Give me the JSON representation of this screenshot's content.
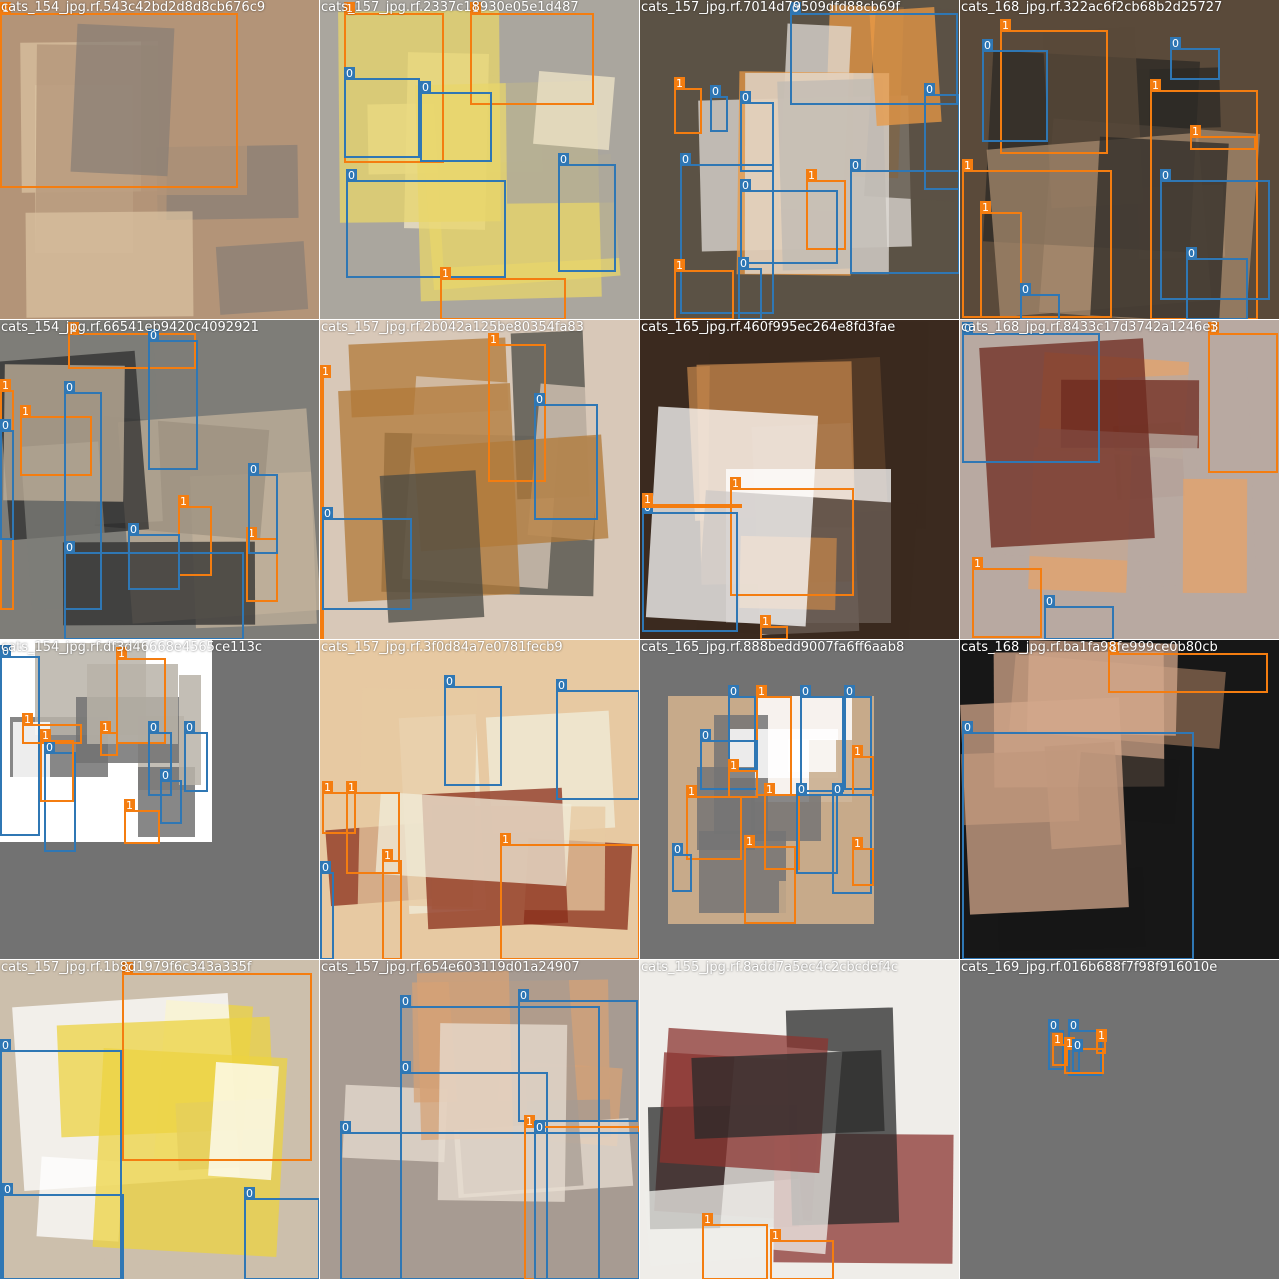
{
  "mosaic": {
    "colors": {
      "class_0": "#2f77b4",
      "class_1": "#f47d10",
      "padding": "#727272"
    },
    "class_labels": [
      "0",
      "1"
    ],
    "tiles": [
      {
        "title": "cats_154_jpg.rf.543c42bd2d8d8cb676c9",
        "palette": [
          "#b39478",
          "#d9c2a0",
          "#8a7f76"
        ],
        "boxes": [
          {
            "cls": "1",
            "l": 0,
            "t": 0,
            "w": 238,
            "h": 175
          }
        ]
      },
      {
        "title": "cats_157_jpg.rf.2337c18930e05e1d487",
        "palette": [
          "#aaa69e",
          "#f0e6c8",
          "#e8d56a"
        ],
        "boxes": [
          {
            "cls": "1",
            "l": 24,
            "t": 10,
            "w": 100,
            "h": 150
          },
          {
            "cls": "1",
            "l": 150,
            "t": 12,
            "w": 124,
            "h": 92
          },
          {
            "cls": "0",
            "l": 24,
            "t": 78,
            "w": 76,
            "h": 80
          },
          {
            "cls": "0",
            "l": 100,
            "t": 92,
            "w": 72,
            "h": 70
          },
          {
            "cls": "0",
            "l": 26,
            "t": 180,
            "w": 160,
            "h": 98
          },
          {
            "cls": "0",
            "l": 238,
            "t": 164,
            "w": 58,
            "h": 108
          },
          {
            "cls": "1",
            "l": 120,
            "t": 278,
            "w": 126,
            "h": 42
          }
        ]
      },
      {
        "title": "cats_157_jpg.rf.7014d79509dfd88cb69f",
        "palette": [
          "#5b5245",
          "#e2ddd8",
          "#e99a45"
        ],
        "boxes": [
          {
            "cls": "0",
            "l": 150,
            "t": 0,
            "w": 168,
            "h": 92
          },
          {
            "cls": "1",
            "l": 34,
            "t": 88,
            "w": 28,
            "h": 46
          },
          {
            "cls": "0",
            "l": 70,
            "t": 96,
            "w": 18,
            "h": 36
          },
          {
            "cls": "0",
            "l": 100,
            "t": 102,
            "w": 34,
            "h": 70
          },
          {
            "cls": "0",
            "l": 40,
            "t": 164,
            "w": 94,
            "h": 150
          },
          {
            "cls": "1",
            "l": 166,
            "t": 180,
            "w": 40,
            "h": 70
          },
          {
            "cls": "0",
            "l": 100,
            "t": 190,
            "w": 98,
            "h": 74
          },
          {
            "cls": "0",
            "l": 210,
            "t": 170,
            "w": 110,
            "h": 104
          },
          {
            "cls": "1",
            "l": 34,
            "t": 270,
            "w": 60,
            "h": 50
          },
          {
            "cls": "0",
            "l": 98,
            "t": 268,
            "w": 24,
            "h": 52
          },
          {
            "cls": "0",
            "l": 284,
            "t": 94,
            "w": 36,
            "h": 96
          }
        ]
      },
      {
        "title": "cats_168_jpg.rf.322ac6f2cb68b2d25727",
        "palette": [
          "#5a4a3a",
          "#a58a6e",
          "#2c2a26"
        ],
        "boxes": [
          {
            "cls": "1",
            "l": 40,
            "t": 30,
            "w": 108,
            "h": 124
          },
          {
            "cls": "0",
            "l": 22,
            "t": 50,
            "w": 66,
            "h": 92
          },
          {
            "cls": "1",
            "l": 190,
            "t": 90,
            "w": 108,
            "h": 240
          },
          {
            "cls": "0",
            "l": 210,
            "t": 48,
            "w": 50,
            "h": 32
          },
          {
            "cls": "1",
            "l": 2,
            "t": 170,
            "w": 150,
            "h": 148
          },
          {
            "cls": "0",
            "l": 226,
            "t": 258,
            "w": 62,
            "h": 62
          },
          {
            "cls": "1",
            "l": 20,
            "t": 212,
            "w": 42,
            "h": 106
          },
          {
            "cls": "0",
            "l": 60,
            "t": 294,
            "w": 40,
            "h": 26
          },
          {
            "cls": "1",
            "l": 230,
            "t": 136,
            "w": 66,
            "h": 14
          },
          {
            "cls": "0",
            "l": 200,
            "t": 180,
            "w": 110,
            "h": 120
          }
        ]
      },
      {
        "title": "cats_154_jpg.rf.66541eb9420c4092921",
        "palette": [
          "#7e7d78",
          "#c2b29b",
          "#2e2e2e"
        ],
        "boxes": [
          {
            "cls": "1",
            "l": 68,
            "t": 10,
            "w": 128,
            "h": 36
          },
          {
            "cls": "0",
            "l": 148,
            "t": 20,
            "w": 50,
            "h": 130
          },
          {
            "cls": "1",
            "l": 0,
            "t": 70,
            "w": 14,
            "h": 220
          },
          {
            "cls": "0",
            "l": 0,
            "t": 110,
            "w": 14,
            "h": 110
          },
          {
            "cls": "1",
            "l": 20,
            "t": 96,
            "w": 72,
            "h": 60
          },
          {
            "cls": "0",
            "l": 64,
            "t": 72,
            "w": 38,
            "h": 218
          },
          {
            "cls": "1",
            "l": 178,
            "t": 186,
            "w": 34,
            "h": 70
          },
          {
            "cls": "0",
            "l": 128,
            "t": 214,
            "w": 52,
            "h": 56
          },
          {
            "cls": "1",
            "l": 246,
            "t": 218,
            "w": 32,
            "h": 64
          },
          {
            "cls": "0",
            "l": 248,
            "t": 154,
            "w": 30,
            "h": 80
          },
          {
            "cls": "0",
            "l": 64,
            "t": 232,
            "w": 180,
            "h": 88
          }
        ]
      },
      {
        "title": "cats_157_jpg.rf.2b042a125be80354fa83",
        "palette": [
          "#d8c8b8",
          "#b27a38",
          "#4b4b44"
        ],
        "boxes": [
          {
            "cls": "1",
            "l": 0,
            "t": 56,
            "w": 2,
            "h": 264
          },
          {
            "cls": "1",
            "l": 168,
            "t": 24,
            "w": 58,
            "h": 138
          },
          {
            "cls": "0",
            "l": 214,
            "t": 84,
            "w": 64,
            "h": 116
          },
          {
            "cls": "0",
            "l": 2,
            "t": 198,
            "w": 90,
            "h": 92
          }
        ]
      },
      {
        "title": "cats_165_jpg.rf.460f995ec264e8fd3fae",
        "palette": [
          "#3b2a1f",
          "#c2844b",
          "#ffffff"
        ],
        "boxes": [
          {
            "cls": "1",
            "l": 2,
            "t": 506,
            "w": 0,
            "h": 0
          },
          {
            "cls": "1",
            "l": 90,
            "t": 168,
            "w": 124,
            "h": 108
          },
          {
            "cls": "0",
            "l": 2,
            "t": 192,
            "w": 96,
            "h": 120
          },
          {
            "cls": "1",
            "l": 2,
            "t": 184,
            "w": 100,
            "h": 2
          },
          {
            "cls": "1",
            "l": 120,
            "t": 306,
            "w": 28,
            "h": 14
          }
        ]
      },
      {
        "title": "cats_168_jpg.rf.8433c17d3742a1246e3",
        "palette": [
          "#b8a9a1",
          "#6e2a1f",
          "#e6a36a"
        ],
        "boxes": [
          {
            "cls": "0",
            "l": 2,
            "t": 10,
            "w": 138,
            "h": 130
          },
          {
            "cls": "1",
            "l": 248,
            "t": 6,
            "w": 70,
            "h": 140
          },
          {
            "cls": "1",
            "l": 12,
            "t": 248,
            "w": 70,
            "h": 70
          },
          {
            "cls": "0",
            "l": 84,
            "t": 286,
            "w": 70,
            "h": 34
          }
        ]
      },
      {
        "title": "cats_154_jpg.rf.df3d46668e4565ce113c",
        "palette": [
          "#b9b3a8",
          "#ffffff",
          "#727272"
        ],
        "boxes": [
          {
            "cls": "0",
            "l": 0,
            "t": 16,
            "w": 40,
            "h": 180
          },
          {
            "cls": "1",
            "l": 116,
            "t": 18,
            "w": 50,
            "h": 86
          },
          {
            "cls": "1",
            "l": 22,
            "t": 84,
            "w": 60,
            "h": 20
          },
          {
            "cls": "1",
            "l": 100,
            "t": 92,
            "w": 18,
            "h": 24
          },
          {
            "cls": "0",
            "l": 148,
            "t": 92,
            "w": 24,
            "h": 64
          },
          {
            "cls": "0",
            "l": 184,
            "t": 92,
            "w": 24,
            "h": 60
          },
          {
            "cls": "0",
            "l": 44,
            "t": 112,
            "w": 32,
            "h": 100
          },
          {
            "cls": "0",
            "l": 160,
            "t": 140,
            "w": 22,
            "h": 44
          },
          {
            "cls": "1",
            "l": 124,
            "t": 170,
            "w": 36,
            "h": 34
          },
          {
            "cls": "1",
            "l": 40,
            "t": 100,
            "w": 34,
            "h": 62
          }
        ]
      },
      {
        "title": "cats_157_jpg.rf.3f0d84a7e0781fecb9",
        "palette": [
          "#e7c9a2",
          "#8a2e1a",
          "#f0ecd9"
        ],
        "boxes": [
          {
            "cls": "0",
            "l": 124,
            "t": 46,
            "w": 58,
            "h": 100
          },
          {
            "cls": "0",
            "l": 236,
            "t": 50,
            "w": 84,
            "h": 110
          },
          {
            "cls": "1",
            "l": 2,
            "t": 152,
            "w": 34,
            "h": 42
          },
          {
            "cls": "1",
            "l": 26,
            "t": 152,
            "w": 54,
            "h": 82
          },
          {
            "cls": "1",
            "l": 180,
            "t": 204,
            "w": 140,
            "h": 116
          },
          {
            "cls": "1",
            "l": 62,
            "t": 220,
            "w": 20,
            "h": 100
          },
          {
            "cls": "0",
            "l": 0,
            "t": 232,
            "w": 14,
            "h": 88
          }
        ]
      },
      {
        "title": "cats_165_jpg.rf.888bedd9007fa6ff6aab8",
        "palette": [
          "#747474",
          "#c7aa8a",
          "#ffffff"
        ],
        "boxes": [
          {
            "cls": "0",
            "l": 88,
            "t": 56,
            "w": 28,
            "h": 74
          },
          {
            "cls": "1",
            "l": 116,
            "t": 56,
            "w": 36,
            "h": 100
          },
          {
            "cls": "0",
            "l": 160,
            "t": 56,
            "w": 44,
            "h": 96
          },
          {
            "cls": "0",
            "l": 204,
            "t": 56,
            "w": 28,
            "h": 94
          },
          {
            "cls": "0",
            "l": 60,
            "t": 100,
            "w": 58,
            "h": 50
          },
          {
            "cls": "1",
            "l": 88,
            "t": 130,
            "w": 30,
            "h": 28
          },
          {
            "cls": "1",
            "l": 212,
            "t": 116,
            "w": 22,
            "h": 40
          },
          {
            "cls": "1",
            "l": 46,
            "t": 156,
            "w": 56,
            "h": 64
          },
          {
            "cls": "1",
            "l": 124,
            "t": 154,
            "w": 36,
            "h": 76
          },
          {
            "cls": "0",
            "l": 156,
            "t": 154,
            "w": 42,
            "h": 80
          },
          {
            "cls": "0",
            "l": 192,
            "t": 154,
            "w": 40,
            "h": 100
          },
          {
            "cls": "1",
            "l": 104,
            "t": 206,
            "w": 52,
            "h": 78
          },
          {
            "cls": "0",
            "l": 32,
            "t": 214,
            "w": 20,
            "h": 38
          },
          {
            "cls": "1",
            "l": 212,
            "t": 208,
            "w": 22,
            "h": 38
          }
        ]
      },
      {
        "title": "cats_168_jpg.rf.ba1fa98fe999ce0b80cb",
        "palette": [
          "#171717",
          "#8b6a52",
          "#d3a78b"
        ],
        "boxes": [
          {
            "cls": "1",
            "l": 148,
            "t": 0,
            "w": 160,
            "h": 40
          },
          {
            "cls": "0",
            "l": 2,
            "t": 92,
            "w": 232,
            "h": 228
          }
        ]
      },
      {
        "title": "cats_157_jpg.rf.1b8d1979f6c343a335f",
        "palette": [
          "#ccbfac",
          "#ecd342",
          "#ffffff"
        ],
        "boxes": [
          {
            "cls": "1",
            "l": 122,
            "t": 0,
            "w": 190,
            "h": 188
          },
          {
            "cls": "0",
            "l": 0,
            "t": 90,
            "w": 122,
            "h": 230
          },
          {
            "cls": "0",
            "l": 2,
            "t": 234,
            "w": 122,
            "h": 86
          },
          {
            "cls": "0",
            "l": 244,
            "t": 238,
            "w": 76,
            "h": 82
          }
        ]
      },
      {
        "title": "cats_157_jpg.rf.654e603119d01a24907",
        "palette": [
          "#a79b92",
          "#d5a276",
          "#e8ddd2"
        ],
        "boxes": [
          {
            "cls": "0",
            "l": 80,
            "t": 46,
            "w": 200,
            "h": 274
          },
          {
            "cls": "0",
            "l": 198,
            "t": 40,
            "w": 120,
            "h": 122
          },
          {
            "cls": "0",
            "l": 80,
            "t": 112,
            "w": 148,
            "h": 208
          },
          {
            "cls": "0",
            "l": 20,
            "t": 172,
            "w": 300,
            "h": 148
          },
          {
            "cls": "1",
            "l": 204,
            "t": 166,
            "w": 116,
            "h": 154
          },
          {
            "cls": "0",
            "l": 214,
            "t": 172,
            "w": 106,
            "h": 148
          }
        ]
      },
      {
        "title": "cats_155_jpg.rf.8add7a5ec4c2cbcdef4c",
        "palette": [
          "#efede9",
          "#8b3430",
          "#2a2a2a"
        ],
        "boxes": [
          {
            "cls": "1",
            "l": 62,
            "t": 264,
            "w": 66,
            "h": 56
          },
          {
            "cls": "1",
            "l": 130,
            "t": 280,
            "w": 64,
            "h": 40
          }
        ]
      },
      {
        "title": "cats_169_jpg.rf.016b688f7f98f916010e",
        "palette": [
          "#727272",
          "#727272",
          "#727272"
        ],
        "boxes": [
          {
            "cls": "0",
            "l": 88,
            "t": 70,
            "w": 16,
            "h": 40
          },
          {
            "cls": "0",
            "l": 108,
            "t": 70,
            "w": 34,
            "h": 46
          },
          {
            "cls": "1",
            "l": 92,
            "t": 84,
            "w": 16,
            "h": 22
          },
          {
            "cls": "1",
            "l": 104,
            "t": 88,
            "w": 40,
            "h": 26
          },
          {
            "cls": "0",
            "l": 112,
            "t": 90,
            "w": 8,
            "h": 22
          },
          {
            "cls": "1",
            "l": 136,
            "t": 80,
            "w": 10,
            "h": 14
          }
        ]
      }
    ]
  }
}
